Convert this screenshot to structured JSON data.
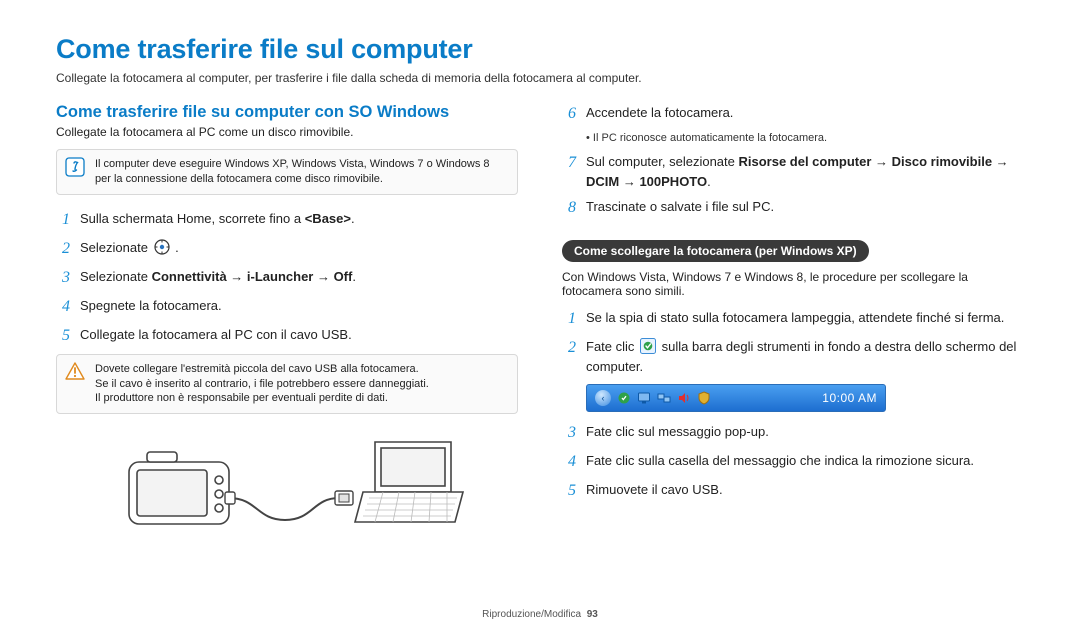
{
  "title": "Come trasferire file sul computer",
  "intro": "Collegate la fotocamera al computer, per trasferire i file dalla scheda di memoria della fotocamera al computer.",
  "left": {
    "subtitle": "Come trasferire file su computer con SO Windows",
    "subdesc": "Collegate la fotocamera al PC come un disco rimovibile.",
    "note1": "Il computer deve eseguire Windows XP, Windows Vista, Windows 7 o Windows 8 per la connessione della fotocamera come disco rimovibile.",
    "steps": [
      {
        "n": "1",
        "html": "Sulla schermata Home, scorrete fino a <b>&lt;Base&gt;</b>."
      },
      {
        "n": "2",
        "html": "Selezionate "
      },
      {
        "n": "3",
        "html": "Selezionate <b>Connettività → i-Launcher → Off</b>."
      },
      {
        "n": "4",
        "html": "Spegnete la fotocamera."
      },
      {
        "n": "5",
        "html": "Collegate la fotocamera al PC con il cavo USB."
      }
    ],
    "warn": "Dovete collegare l'estremità piccola del cavo USB alla fotocamera.\nSe il cavo è inserito al contrario, i file potrebbero essere danneggiati.\nIl produttore non è responsabile per eventuali perdite di dati."
  },
  "right": {
    "steps_top": [
      {
        "n": "6",
        "html": "Accendete la fotocamera."
      },
      {
        "n": "7",
        "html": "Sul computer, selezionate <b>Risorse del computer → Disco rimovibile → DCIM → 100PHOTO</b>."
      },
      {
        "n": "8",
        "html": "Trascinate o salvate i file sul PC."
      }
    ],
    "sub6": "Il PC riconosce automaticamente la fotocamera.",
    "pill": "Come scollegare la fotocamera (per Windows XP)",
    "pill_desc": "Con Windows Vista, Windows 7 e Windows 8, le procedure per scollegare la fotocamera sono simili.",
    "steps_xp": [
      {
        "n": "1",
        "html": "Se la spia di stato sulla fotocamera lampeggia, attendete finché si ferma."
      },
      {
        "n": "2",
        "html_pre": "Fate clic ",
        "html_post": " sulla barra degli strumenti in fondo a destra dello schermo del computer."
      },
      {
        "n": "3",
        "html": "Fate clic sul messaggio pop-up."
      },
      {
        "n": "4",
        "html": "Fate clic sulla casella del messaggio che indica la rimozione sicura."
      },
      {
        "n": "5",
        "html": "Rimuovete il cavo USB."
      }
    ],
    "taskbar_time": "10:00 AM"
  },
  "footer": {
    "section": "Riproduzione/Modifica",
    "page": "93"
  }
}
